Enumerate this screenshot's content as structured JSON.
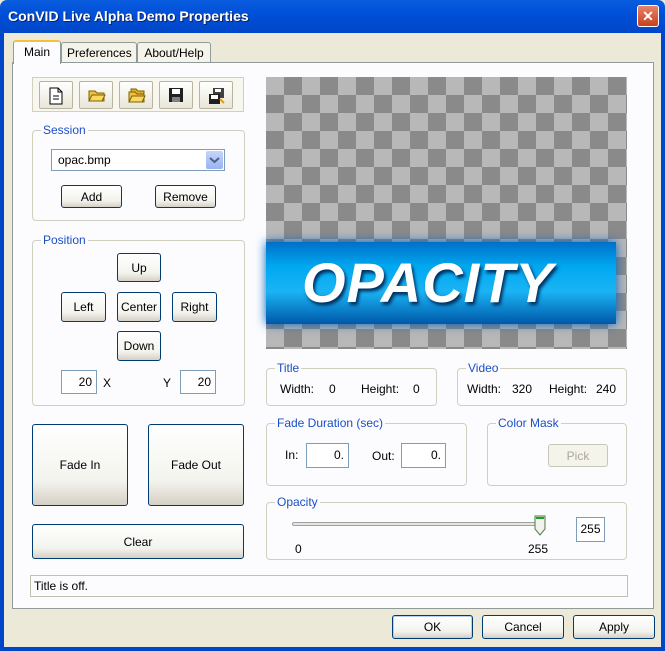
{
  "window": {
    "title": "ConVID Live Alpha Demo Properties"
  },
  "tabs": [
    "Main",
    "Preferences",
    "About/Help"
  ],
  "toolbar": {
    "icons": [
      "new-document-icon",
      "open-folder-icon",
      "open-multiple-icon",
      "save-icon",
      "save-all-icon"
    ]
  },
  "session": {
    "label": "Session",
    "selected": "opac.bmp",
    "add": "Add",
    "remove": "Remove"
  },
  "position": {
    "label": "Position",
    "up": "Up",
    "left": "Left",
    "center": "Center",
    "right": "Right",
    "down": "Down",
    "x_value": "20",
    "x_label": "X",
    "y_label": "Y",
    "y_value": "20"
  },
  "fade": {
    "in": "Fade In",
    "out": "Fade Out",
    "clear": "Clear"
  },
  "preview": {
    "text": "OPACITY"
  },
  "title_info": {
    "label": "Title",
    "width_label": "Width:",
    "width": "0",
    "height_label": "Height:",
    "height": "0"
  },
  "video_info": {
    "label": "Video",
    "width_label": "Width:",
    "width": "320",
    "height_label": "Height:",
    "height": "240"
  },
  "fade_duration": {
    "label": "Fade Duration (sec)",
    "in_label": "In:",
    "in_value": "0.",
    "out_label": "Out:",
    "out_value": "0."
  },
  "color_mask": {
    "label": "Color Mask",
    "pick": "Pick"
  },
  "opacity": {
    "label": "Opacity",
    "min": "0",
    "max": "255",
    "value": "255",
    "level": 1.0
  },
  "status": "Title is off.",
  "buttons": {
    "ok": "OK",
    "cancel": "Cancel",
    "apply": "Apply"
  }
}
